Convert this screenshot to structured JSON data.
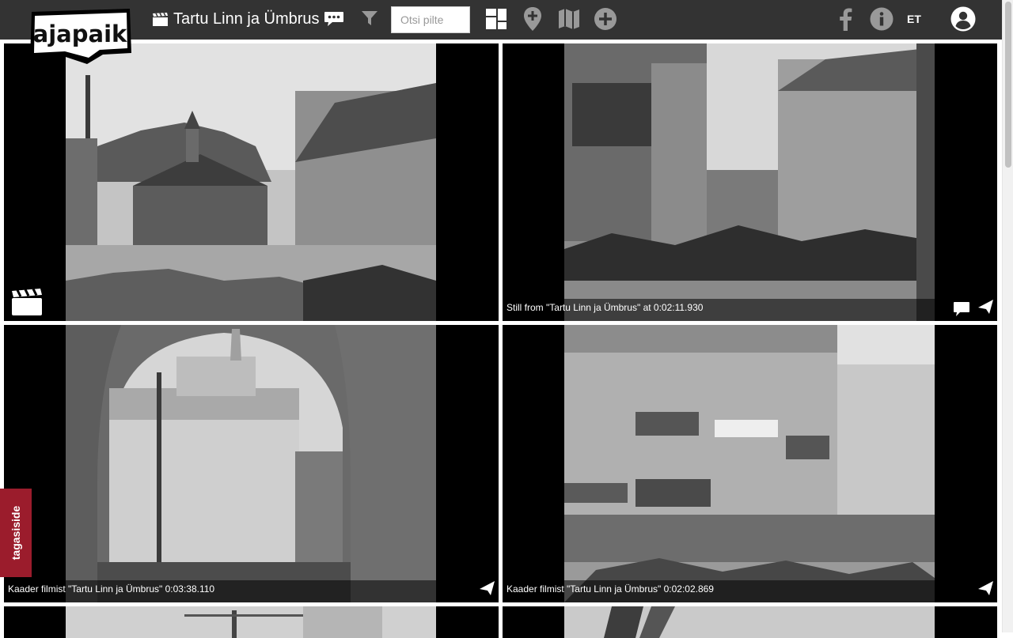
{
  "header": {
    "logo_text": "ajapaik",
    "album_title": "Tartu Linn ja Ümbrus",
    "search_placeholder": "Otsi pilte",
    "language": "ET"
  },
  "photos": [
    {
      "caption": "",
      "type": "film"
    },
    {
      "caption": "Still from \"Tartu Linn ja Ümbrus\" at 0:02:11.930",
      "type": "still"
    },
    {
      "caption": "Kaader filmist \"Tartu Linn ja Ümbrus\" 0:03:38.110",
      "type": "still"
    },
    {
      "caption": "Kaader filmist \"Tartu Linn ja Ümbrus\" 0:02:02.869",
      "type": "still"
    }
  ],
  "feedback": {
    "label": "tagasiside"
  },
  "colors": {
    "header_bg": "#333333",
    "icon_gray": "#999999",
    "feedback_bg": "#9b1c2c"
  }
}
